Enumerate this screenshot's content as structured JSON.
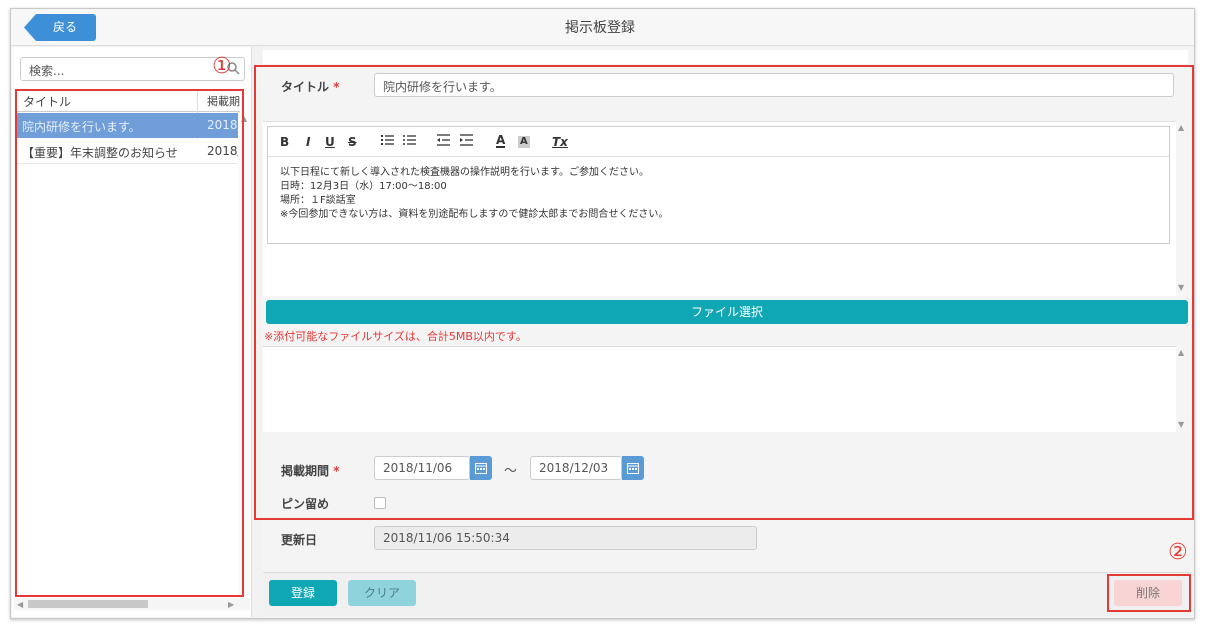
{
  "header": {
    "back_label": "戻る",
    "page_title": "掲示板登録"
  },
  "sidebar": {
    "search_placeholder": "検索...",
    "columns": [
      "タイトル",
      "掲載期"
    ],
    "rows": [
      {
        "title": "院内研修を行います。",
        "date": "2018/",
        "selected": true
      },
      {
        "title": "【重要】年末調整のお知らせ",
        "date": "2018/",
        "selected": false
      }
    ]
  },
  "annotations": {
    "mark1": "①",
    "mark2": "②"
  },
  "form": {
    "title_label": "タイトル",
    "required_mark": "*",
    "title_value": "院内研修を行います。",
    "editor_toolbar": [
      "B",
      "I",
      "U",
      "S",
      "ordered-list-icon",
      "unordered-list-icon",
      "outdent-icon",
      "indent-icon",
      "A",
      "A",
      "Tx"
    ],
    "body_lines": [
      "以下日程にて新しく導入された検査機器の操作説明を行います。ご参加ください。",
      "日時：12月3日（水）17:00～18:00",
      "場所：１F談話室",
      "※今回参加できない方は、資料を別途配布しますので健診太郎までお問合せください。"
    ],
    "file_button_label": "ファイル選択",
    "file_note": "※添付可能なファイルサイズは、合計5MB以内です。",
    "period_label": "掲載期間",
    "period_start": "2018/11/06",
    "period_sep": "～",
    "period_end": "2018/12/03",
    "pin_label": "ピン留め",
    "updated_label": "更新日",
    "updated_value": "2018/11/06 15:50:34"
  },
  "footer": {
    "register_label": "登録",
    "clear_label": "クリア",
    "delete_label": "削除"
  },
  "colors": {
    "accent": "#10a7b5",
    "back_button": "#3d8fd8",
    "selected_row": "#6f9ed9",
    "annotation_red": "#e53935"
  }
}
